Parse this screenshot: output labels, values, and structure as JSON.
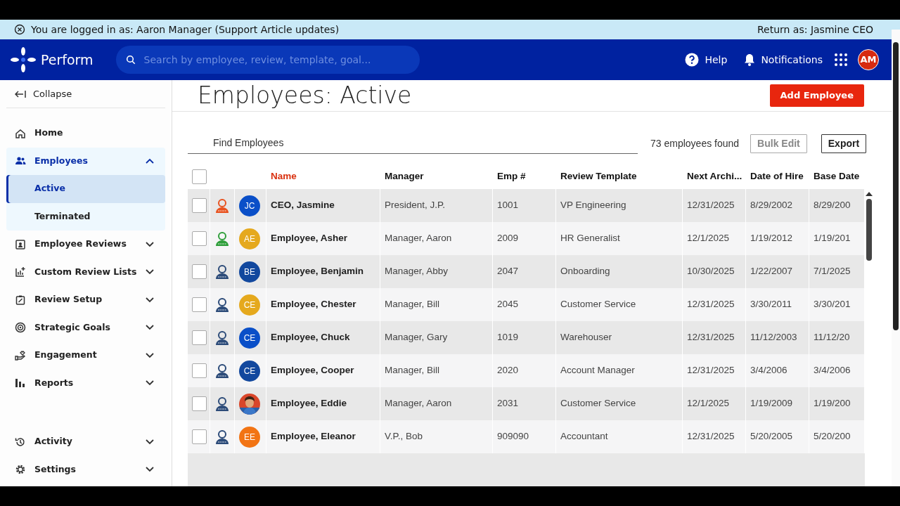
{
  "impersonation_bar": {
    "message": "You are logged in as: Aaron Manager (Support Article updates)",
    "return_link": "Return as: Jasmine CEO"
  },
  "navbar": {
    "brand": "Perform",
    "search": {
      "placeholder": "Search by employee, review, template, goal..."
    },
    "help": "Help",
    "notifications": "Notifications",
    "avatar": "AM"
  },
  "sidebar": {
    "collapse": "Collapse",
    "items": [
      {
        "label": "Home",
        "selected": false,
        "has_chevron": false
      },
      {
        "label": "Employees",
        "expanded": true,
        "selected": true,
        "has_chevron": true,
        "children": [
          {
            "label": "Active",
            "selected": true
          },
          {
            "label": "Terminated",
            "selected": false
          }
        ]
      },
      {
        "label": "Employee Reviews",
        "expanded": false,
        "selected": false,
        "has_chevron": true
      },
      {
        "label": "Custom Review Lists",
        "expanded": false,
        "selected": false,
        "has_chevron": true
      },
      {
        "label": "Review Setup",
        "expanded": false,
        "selected": false,
        "has_chevron": true
      },
      {
        "label": "Strategic Goals",
        "expanded": false,
        "selected": false,
        "has_chevron": true
      },
      {
        "label": "Engagement",
        "expanded": false,
        "selected": false,
        "has_chevron": true
      },
      {
        "label": "Reports",
        "expanded": false,
        "selected": false,
        "has_chevron": true
      }
    ],
    "bottom_items": [
      {
        "label": "Activity",
        "expanded": false
      },
      {
        "label": "Settings",
        "expanded": false
      }
    ]
  },
  "page": {
    "title": "Employees: Active",
    "add_button": "Add Employee"
  },
  "toolbar": {
    "search": {
      "placeholder": "Find Employees"
    },
    "count": "73 employees found",
    "bulk_edit": {
      "label": "Bulk Edit",
      "disabled": true
    },
    "export": "Export"
  },
  "table": {
    "select_all": {
      "checked": false
    },
    "columns": [
      {
        "label": "Name",
        "sorted": true
      },
      {
        "label": "Manager",
        "sorted": false
      },
      {
        "label": "Emp #",
        "sorted": false
      },
      {
        "label": "Review Template",
        "sorted": false
      },
      {
        "label": "Next Archi...",
        "sorted": false
      },
      {
        "label": "Date of Hire",
        "sorted": false
      },
      {
        "label": "Base Date",
        "sorted": false
      }
    ],
    "rows": [
      {
        "checked": false,
        "color": "#e8521f",
        "avatar": {
          "kind": "initials",
          "initials": "JC",
          "color": "#0a4fc8"
        },
        "cells": [
          "CEO, Jasmine",
          "President, J.P.",
          "1001",
          "VP Engineering",
          "12/31/2025",
          "8/29/2002",
          "8/29/200"
        ]
      },
      {
        "checked": false,
        "color": "#2e9e3a",
        "avatar": {
          "kind": "initials",
          "initials": "AE",
          "color": "#e5a91e"
        },
        "cells": [
          "Employee, Asher",
          "Manager, Aaron",
          "2009",
          "HR Generalist",
          "12/1/2025",
          "1/19/2012",
          "1/19/201"
        ]
      },
      {
        "checked": false,
        "color": "#2b4a78",
        "avatar": {
          "kind": "initials",
          "initials": "BE",
          "color": "#12489e"
        },
        "cells": [
          "Employee, Benjamin",
          "Manager, Abby",
          "2047",
          "Onboarding",
          "10/30/2025",
          "1/22/2007",
          "7/1/2025"
        ]
      },
      {
        "checked": false,
        "color": "#2b4a78",
        "avatar": {
          "kind": "initials",
          "initials": "CE",
          "color": "#e5a91e"
        },
        "cells": [
          "Employee, Chester",
          "Manager, Bill",
          "2045",
          "Customer Service",
          "12/31/2025",
          "3/30/2011",
          "3/30/201"
        ]
      },
      {
        "checked": false,
        "color": "#2b4a78",
        "avatar": {
          "kind": "initials",
          "initials": "CE",
          "color": "#0a4fc8"
        },
        "cells": [
          "Employee, Chuck",
          "Manager, Gary",
          "1019",
          "Warehouser",
          "12/31/2025",
          "11/12/2003",
          "11/12/20"
        ]
      },
      {
        "checked": false,
        "color": "#2b4a78",
        "avatar": {
          "kind": "initials",
          "initials": "CE",
          "color": "#12489e"
        },
        "cells": [
          "Employee, Cooper",
          "Manager, Bill",
          "2020",
          "Account Manager",
          "12/31/2025",
          "3/4/2006",
          "3/4/2006"
        ]
      },
      {
        "checked": false,
        "color": "#2b4a78",
        "avatar": {
          "kind": "picture"
        },
        "cells": [
          "Employee, Eddie",
          "Manager, Aaron",
          "2031",
          "Customer Service",
          "12/1/2025",
          "1/19/2009",
          "1/19/200"
        ]
      },
      {
        "checked": false,
        "color": "#2b4a78",
        "avatar": {
          "kind": "initials",
          "initials": "EE",
          "color": "#f27414"
        },
        "cells": [
          "Employee, Eleanor",
          "V.P., Bob",
          "909090",
          "Accountant",
          "12/31/2025",
          "5/20/2005",
          "5/20/200"
        ]
      }
    ]
  }
}
